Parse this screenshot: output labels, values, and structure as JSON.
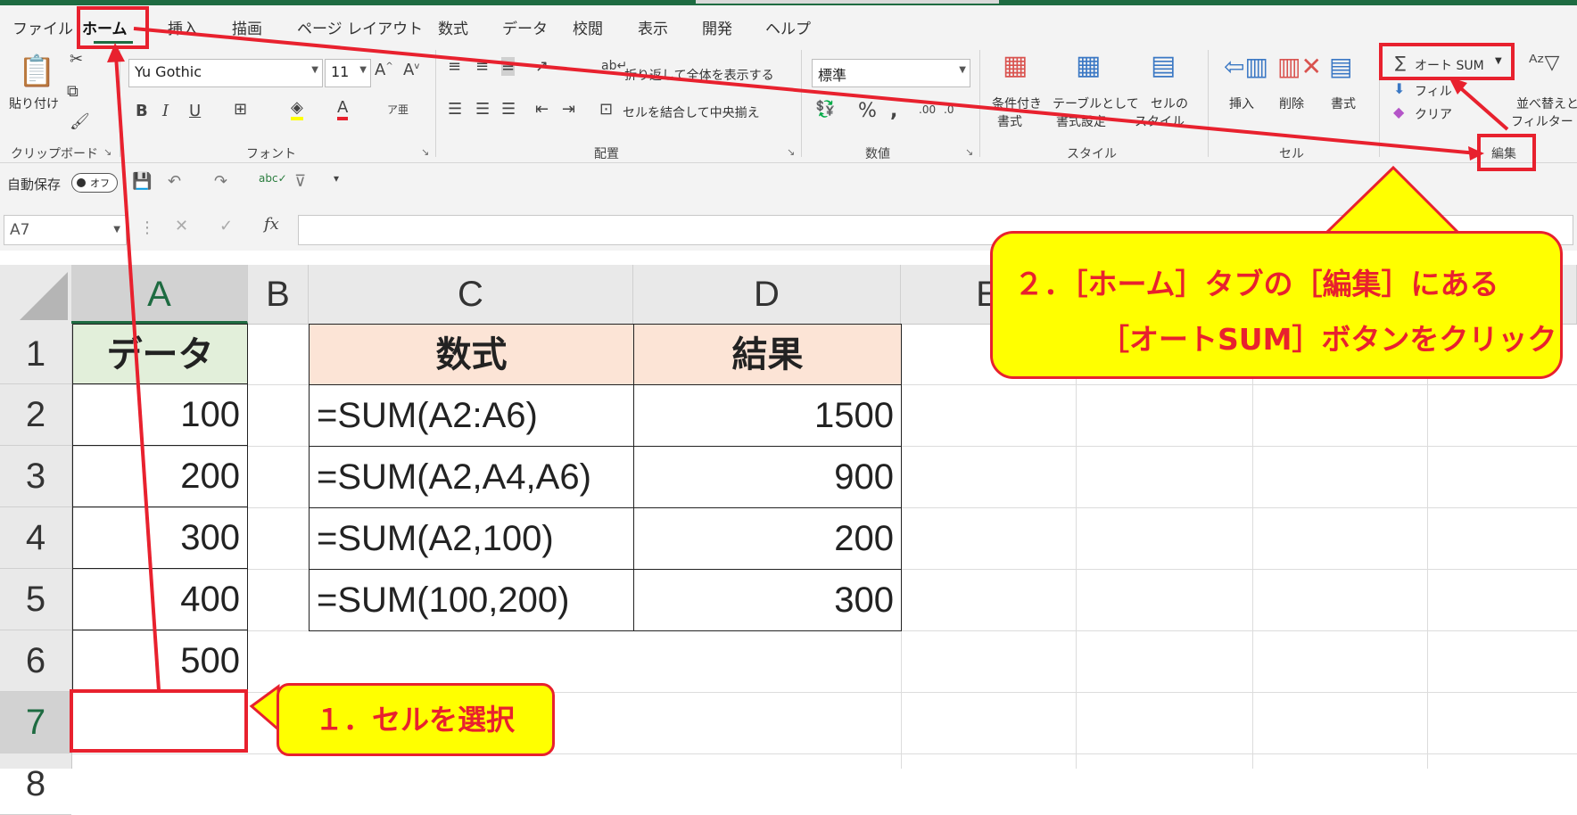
{
  "tabs": [
    "ファイル",
    "ホーム",
    "挿入",
    "描画",
    "ページ レイアウト",
    "数式",
    "データ",
    "校閲",
    "表示",
    "開発",
    "ヘルプ"
  ],
  "ribbon": {
    "clipboard": {
      "paste": "貼り付け",
      "label": "クリップボード"
    },
    "font": {
      "name": "Yu Gothic",
      "size": "11",
      "label": "フォント",
      "bold": "B",
      "italic": "I",
      "underline": "U"
    },
    "alignment": {
      "wrap": "折り返して全体を表示する",
      "merge": "セルを結合して中央揃え",
      "label": "配置"
    },
    "number": {
      "format": "標準",
      "label": "数値"
    },
    "styles": {
      "cond_line1": "条件付き",
      "cond_line2": "書式",
      "table_line1": "テーブルとして",
      "table_line2": "書式設定",
      "cell_line1": "セルの",
      "cell_line2": "スタイル",
      "label": "スタイル"
    },
    "cells": {
      "insert": "挿入",
      "delete": "削除",
      "format": "書式",
      "label": "セル"
    },
    "editing": {
      "autosum": "オート SUM",
      "fill": "フィル",
      "clear": "クリア",
      "sort_line1": "並べ替えと",
      "sort_line2": "フィルター",
      "label": "編集"
    }
  },
  "qat": {
    "autosave_label": "自動保存",
    "autosave_state": "オフ"
  },
  "formula_bar": {
    "namebox": "A7",
    "fx": "fx",
    "value": ""
  },
  "columns": [
    "A",
    "B",
    "C",
    "D",
    "E"
  ],
  "rows": [
    "1",
    "2",
    "3",
    "4",
    "5",
    "6",
    "7",
    "8"
  ],
  "sheet": {
    "a_header": "データ",
    "a_values": [
      "100",
      "200",
      "300",
      "400",
      "500"
    ],
    "c_header": "数式",
    "d_header": "結果",
    "formulas": [
      "=SUM(A2:A6)",
      "=SUM(A2,A4,A6)",
      "=SUM(A2,100)",
      "=SUM(100,200)"
    ],
    "results": [
      "1500",
      "900",
      "200",
      "300"
    ]
  },
  "callouts": {
    "step1": "１．セルを選択",
    "step2_line1": "２．［ホーム］タブの［編集］にある",
    "step2_line2": "［オートSUM］ボタンをクリック"
  },
  "colors": {
    "accent": "#1e6b41",
    "annotation": "#e8212e",
    "callout_bg": "#ffff00",
    "data_header_bg": "#e2efda",
    "formula_header_bg": "#fce4d6"
  }
}
